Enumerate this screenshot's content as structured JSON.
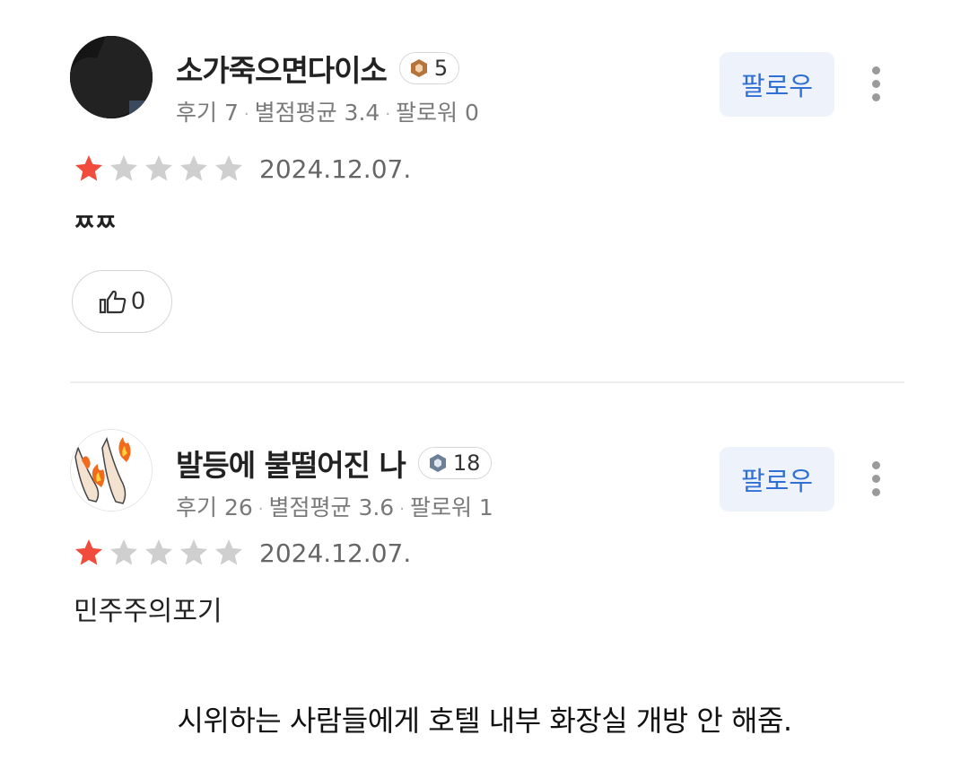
{
  "reviews": [
    {
      "nickname": "소가죽으면다이소",
      "level": "5",
      "stats": {
        "reviews": "후기 7",
        "avg": "별점평균 3.4",
        "followers": "팔로워 0"
      },
      "follow_label": "팔로우",
      "rating": 1,
      "date": "2024.12.07.",
      "text": "ㅉㅉ",
      "likes": "0"
    },
    {
      "nickname": "발등에 불떨어진 나",
      "level": "18",
      "stats": {
        "reviews": "후기 26",
        "avg": "별점평균 3.6",
        "followers": "팔로워 1"
      },
      "follow_label": "팔로우",
      "rating": 1,
      "date": "2024.12.07.",
      "text": "민주주의포기"
    }
  ],
  "caption": "시위하는 사람들에게 호텔 내부 화장실 개방 안 해줌.",
  "colors": {
    "star_filled": "#f04b3c",
    "star_empty": "#cfcfcf",
    "follow_text": "#2f6fd6",
    "follow_bg": "#eef3fb"
  },
  "icons": {
    "badge1": "hexagon-level-icon",
    "badge2": "hexagon-level-icon",
    "like": "thumbs-up-icon",
    "more": "more-vertical-icon"
  }
}
